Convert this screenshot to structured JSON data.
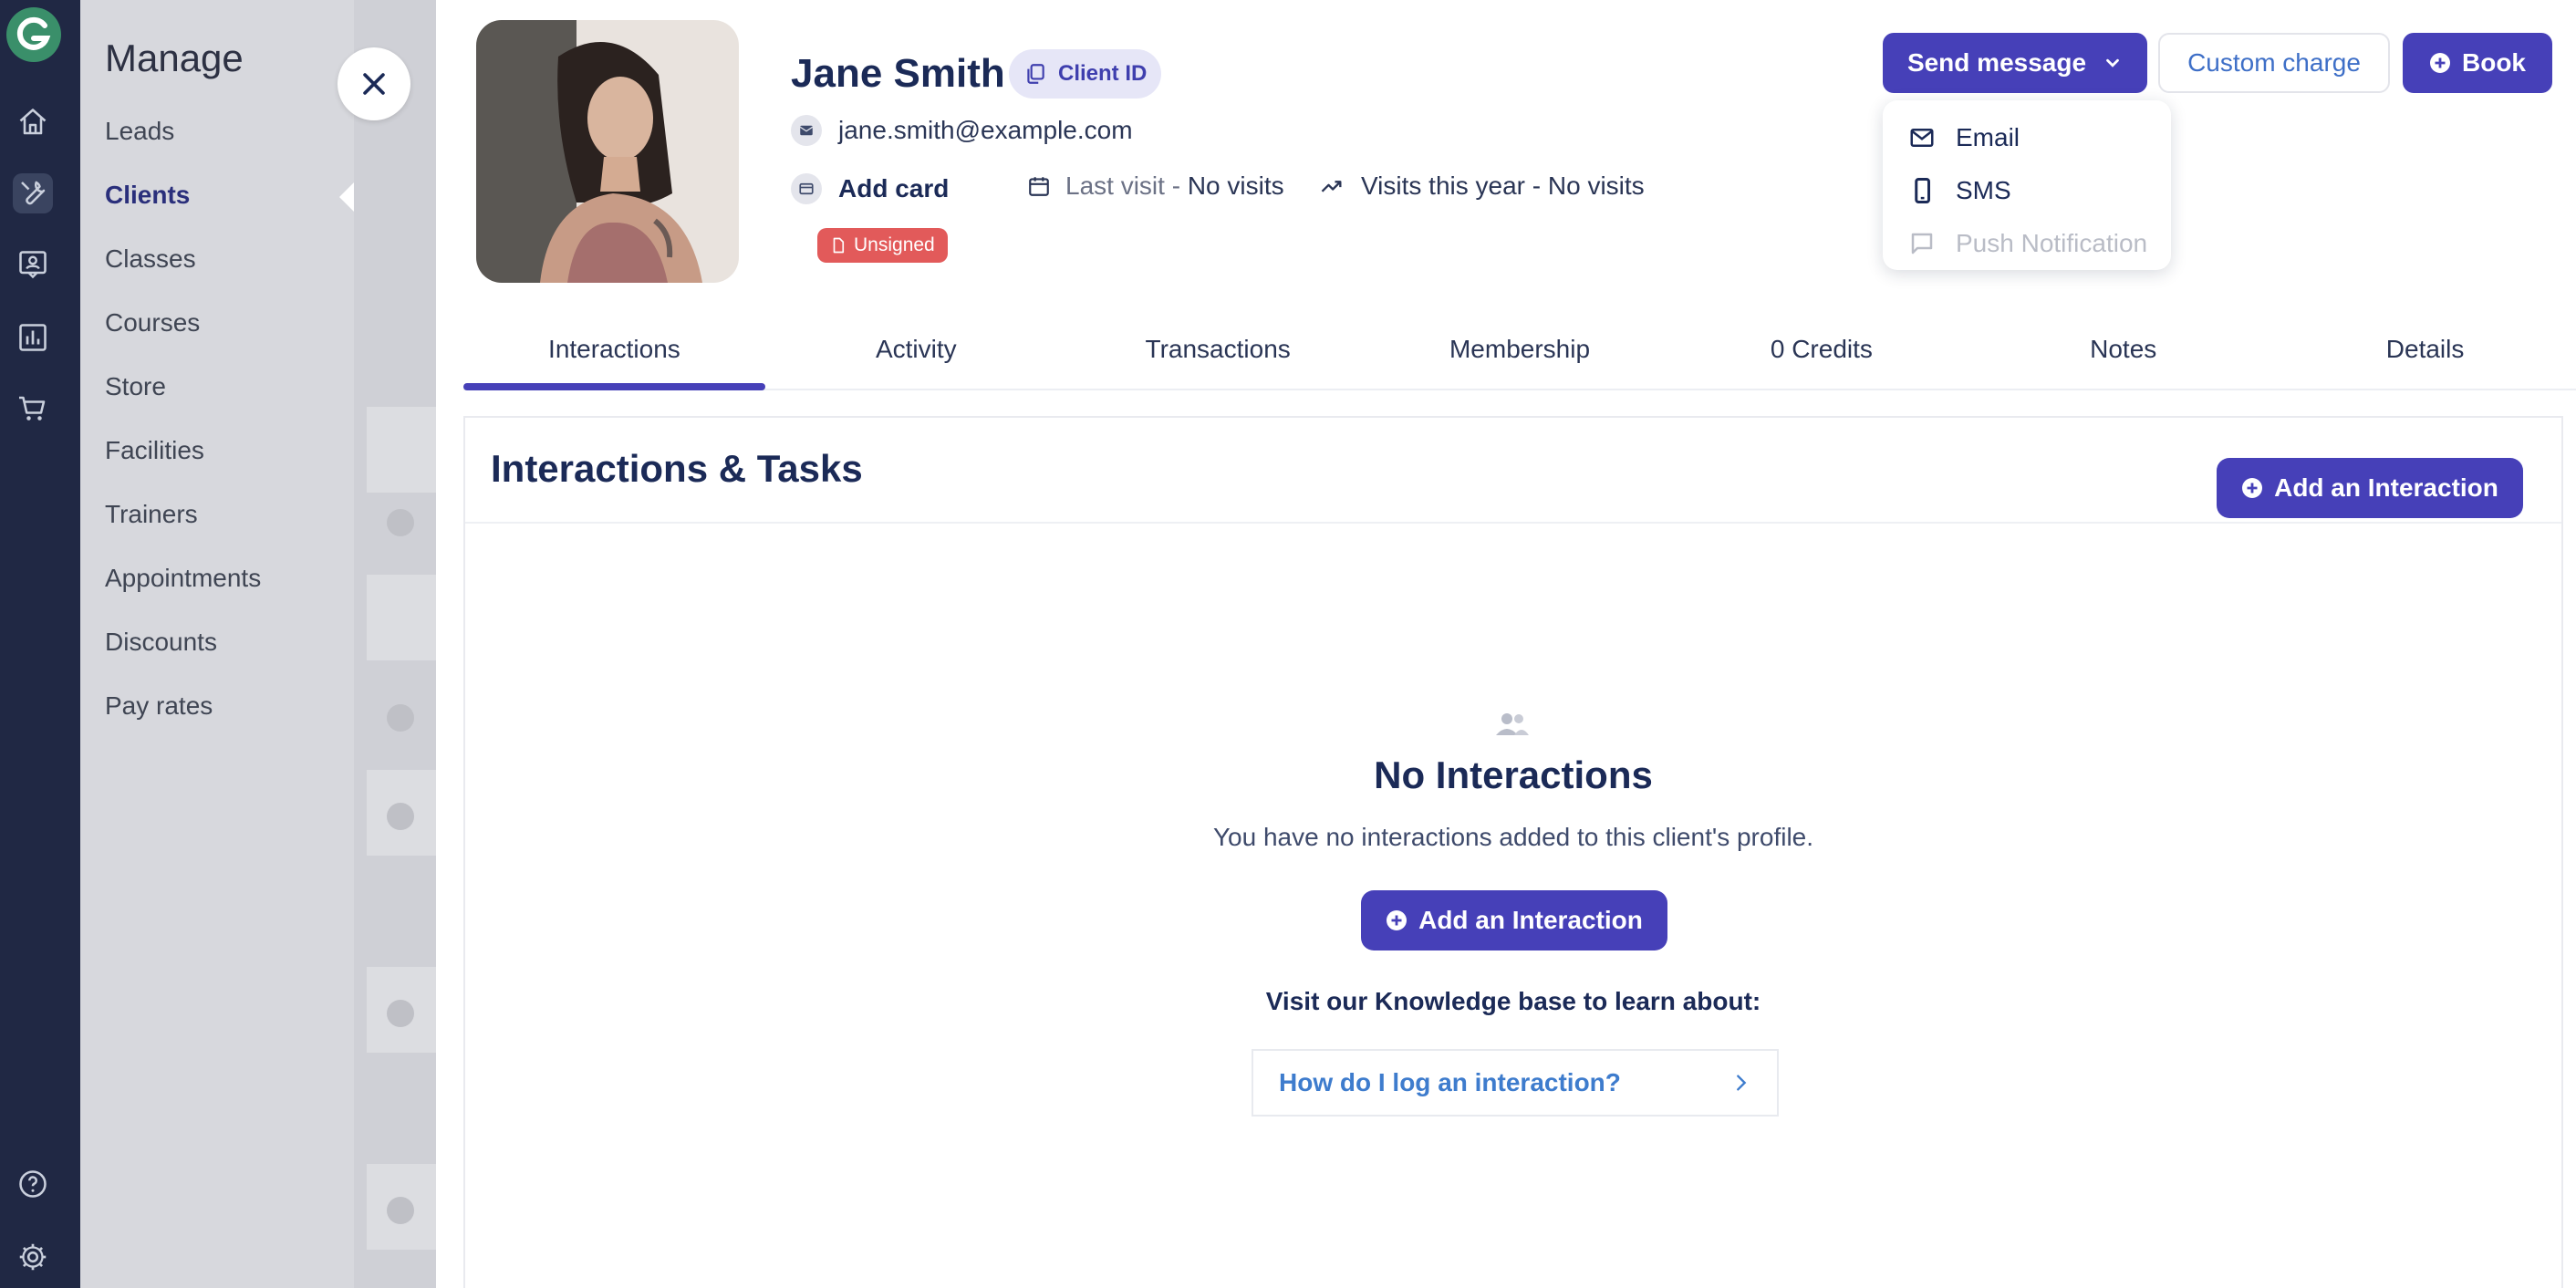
{
  "rail": {
    "items": [
      {
        "icon": "home-icon"
      },
      {
        "icon": "wrench-icon",
        "active": true
      },
      {
        "icon": "profile-card-icon"
      },
      {
        "icon": "bar-chart-icon"
      },
      {
        "icon": "cart-icon"
      }
    ],
    "bottom": [
      "help-icon",
      "gear-icon"
    ]
  },
  "manage": {
    "title": "Manage",
    "items": [
      {
        "label": "Leads"
      },
      {
        "label": "Clients",
        "active": true
      },
      {
        "label": "Classes"
      },
      {
        "label": "Courses"
      },
      {
        "label": "Store"
      },
      {
        "label": "Facilities"
      },
      {
        "label": "Trainers"
      },
      {
        "label": "Appointments"
      },
      {
        "label": "Discounts"
      },
      {
        "label": "Pay rates"
      }
    ]
  },
  "profile": {
    "name": "Jane Smith",
    "client_id_label": "Client ID",
    "email": "jane.smith@example.com",
    "add_card_label": "Add card",
    "last_visit_label": "Last visit - ",
    "last_visit_value": "No visits",
    "visits_year_label": "Visits this year - No visits",
    "unsigned_label": "Unsigned"
  },
  "actions": {
    "send_message": "Send message",
    "custom_charge": "Custom charge",
    "book": "Book",
    "menu": [
      {
        "label": "Email",
        "icon": "mail-icon",
        "disabled": false
      },
      {
        "label": "SMS",
        "icon": "phone-icon",
        "disabled": false
      },
      {
        "label": "Push Notification",
        "icon": "chat-icon",
        "disabled": true
      }
    ]
  },
  "tabs": [
    {
      "label": "Interactions",
      "active": true
    },
    {
      "label": "Activity"
    },
    {
      "label": "Transactions"
    },
    {
      "label": "Membership"
    },
    {
      "label": "0 Credits"
    },
    {
      "label": "Notes"
    },
    {
      "label": "Details"
    }
  ],
  "interactions": {
    "title": "Interactions & Tasks",
    "add_label": "Add an Interaction",
    "empty_title": "No Interactions",
    "empty_sub": "You have no interactions added to this client's profile.",
    "kb_title": "Visit our Knowledge base to learn about:",
    "kb_link": "How do I log an interaction?"
  },
  "colors": {
    "rail_bg": "#202844",
    "accent": "#4640b8",
    "unsigned": "#e25a5a",
    "link": "#3e7ccd"
  }
}
